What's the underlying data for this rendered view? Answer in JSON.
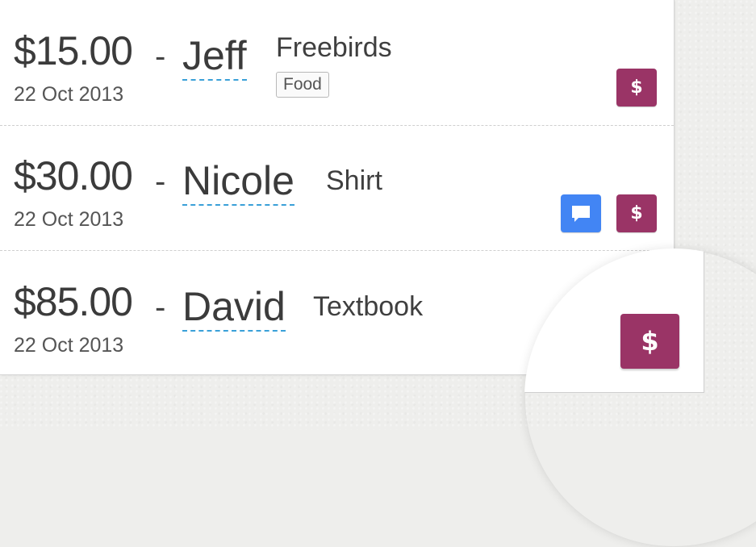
{
  "transactions": [
    {
      "amount": "$15.00",
      "dash": "-",
      "name": "Jeff",
      "description": "Freebirds",
      "date": "22 Oct 2013",
      "tag": "Food",
      "actions": {
        "pay_icon": "dollar-icon"
      }
    },
    {
      "amount": "$30.00",
      "dash": "-",
      "name": "Nicole",
      "description": "Shirt",
      "date": "22 Oct 2013",
      "actions": {
        "message_icon": "chat-bubble-icon",
        "pay_icon": "dollar-icon"
      }
    },
    {
      "amount": "$85.00",
      "dash": "-",
      "name": "David",
      "description": "Textbook",
      "date": "22 Oct 2013",
      "actions": {
        "pay_icon": "dollar-icon"
      }
    }
  ],
  "icons": {
    "dollar": "$"
  },
  "colors": {
    "pay_button": "#9a3466",
    "message_button": "#4285f4",
    "name_underline": "#3aa0d8",
    "background": "#eeeeec"
  }
}
